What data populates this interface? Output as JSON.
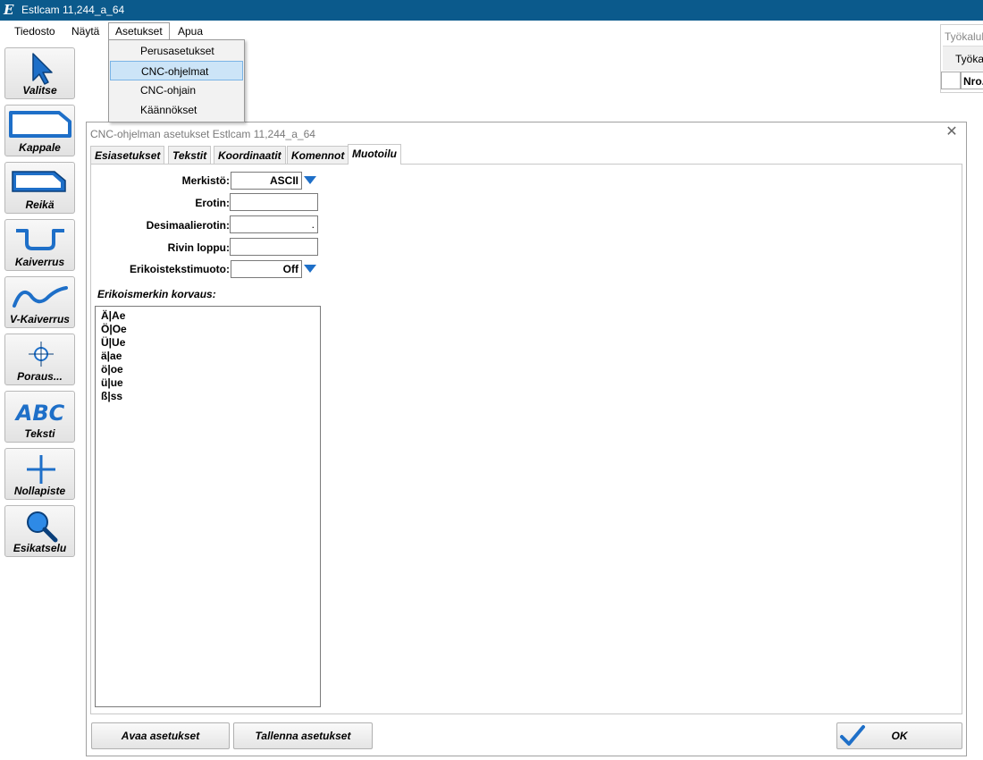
{
  "window": {
    "title": "Estlcam 11,244_a_64",
    "app_icon_glyph": "E"
  },
  "menubar": {
    "items": [
      {
        "label": "Tiedosto"
      },
      {
        "label": "Näytä"
      },
      {
        "label": "Asetukset"
      },
      {
        "label": "Apua"
      }
    ]
  },
  "dropdown": {
    "items": [
      {
        "label": "Perusasetukset"
      },
      {
        "label": "CNC-ohjelmat"
      },
      {
        "label": "CNC-ohjain"
      },
      {
        "label": "Käännökset"
      }
    ],
    "selected": "CNC-ohjelmat"
  },
  "toolbar": {
    "buttons": [
      {
        "label": "Valitse",
        "icon": "cursor-arrow-icon"
      },
      {
        "label": "Kappale",
        "icon": "part-outline-icon"
      },
      {
        "label": "Reikä",
        "icon": "hole-pocket-icon"
      },
      {
        "label": "Kaiverrus",
        "icon": "engrave-groove-icon"
      },
      {
        "label": "V-Kaiverrus",
        "icon": "v-carve-icon"
      },
      {
        "label": "Poraus...",
        "icon": "drill-crosshair-icon"
      },
      {
        "label": "Teksti",
        "icon": "text-abc-icon"
      },
      {
        "label": "Nollapiste",
        "icon": "origin-cross-icon"
      },
      {
        "label": "Esikatselu",
        "icon": "magnifier-icon"
      }
    ]
  },
  "tool_panel": {
    "title": "Työkalul",
    "tab": "Työkal",
    "column_number": "Nro."
  },
  "dialog": {
    "title": "CNC-ohjelman asetukset Estlcam 11,244_a_64",
    "tabs": [
      {
        "label": "Esiasetukset"
      },
      {
        "label": "Tekstit"
      },
      {
        "label": "Koordinaatit"
      },
      {
        "label": "Komennot"
      },
      {
        "label": "Muotoilu"
      }
    ],
    "active_tab": "Muotoilu",
    "fields": {
      "charset": {
        "label": "Merkistö:",
        "value": "ASCII"
      },
      "separator": {
        "label": "Erotin:",
        "value": ""
      },
      "decimal_separator": {
        "label": "Desimaalierotin:",
        "value": "."
      },
      "line_end": {
        "label": "Rivin loppu:",
        "value": ""
      },
      "special_text_format": {
        "label": "Erikoistekstimuoto:",
        "value": "Off"
      }
    },
    "replace_label": "Erikoismerkin korvaus:",
    "replace_list": [
      "Ä|Ae",
      "Ö|Oe",
      "Ü|Ue",
      "ä|ae",
      "ö|oe",
      "ü|ue",
      "ß|ss"
    ],
    "buttons": {
      "open": "Avaa asetukset",
      "save": "Tallenna asetukset",
      "ok": "OK"
    }
  },
  "colors": {
    "titlebar": "#0b5a8c",
    "accent": "#1e6fc8",
    "selection": "#cce4f7"
  }
}
